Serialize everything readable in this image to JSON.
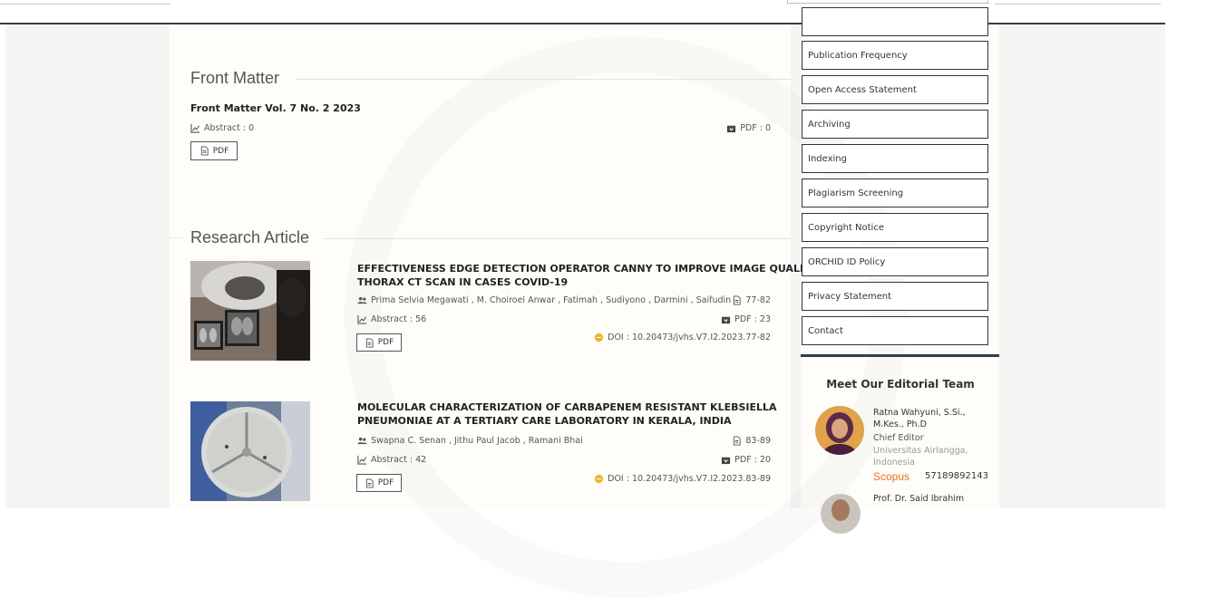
{
  "front_matter": {
    "heading": "Front Matter",
    "title": "Front Matter Vol. 7 No. 2 2023",
    "abstract": "Abstract : 0",
    "pdf_count": "PDF : 0",
    "pdf_button": "PDF"
  },
  "research": {
    "heading": "Research Article",
    "articles": [
      {
        "title_line1": "EFFECTIVENESS EDGE DETECTION OPERATOR CANNY TO IMPROVE IMAGE QUALITY",
        "title_line2": "THORAX CT SCAN IN CASES COVID-19",
        "authors": "Prima Selvia Megawati , M. Choiroel Anwar , Fatimah , Sudiyono , Darmini , Saifudin",
        "pages": "77-82",
        "abstract": "Abstract : 56",
        "pdf_count": "PDF : 23",
        "doi": "DOI : 10.20473/jvhs.V7.I2.2023.77-82",
        "pdf_button": "PDF"
      },
      {
        "title_line1": "MOLECULAR CHARACTERIZATION OF CARBAPENEM RESISTANT KLEBSIELLA",
        "title_line2": "PNEUMONIAE AT A TERTIARY CARE LABORATORY IN KERALA, INDIA",
        "authors": "Swapna C. Senan , Jithu Paul Jacob , Ramani Bhai",
        "pages": "83-89",
        "abstract": "Abstract : 42",
        "pdf_count": "PDF : 20",
        "doi": "DOI : 10.20473/jvhs.V7.I2.2023.83-89",
        "pdf_button": "PDF"
      }
    ]
  },
  "sidebar": {
    "items": [
      "Publication Frequency",
      "Open Access Statement",
      "Archiving",
      "Indexing",
      "Plagiarism Screening",
      "Copyright Notice",
      "ORCHID ID Policy",
      "Privacy Statement",
      "Contact"
    ],
    "editorial": {
      "heading": "Meet Our Editorial Team",
      "members": [
        {
          "name_line1": "Ratna Wahyuni, S.Si.,",
          "name_line2": "M.Kes., Ph.D",
          "role": "Chief Editor",
          "affiliation_line1": "Universitas Airlangga,",
          "affiliation_line2": "Indonesia",
          "scopus_label": "Scopus",
          "scopus_id": "57189892143"
        },
        {
          "name_line1": "Prof. Dr. Said Ibrahim"
        }
      ]
    }
  },
  "colors": {
    "header_rule": "#2f3e4d",
    "scopus": "#e9711c",
    "doi_icon": "#f0b429"
  }
}
